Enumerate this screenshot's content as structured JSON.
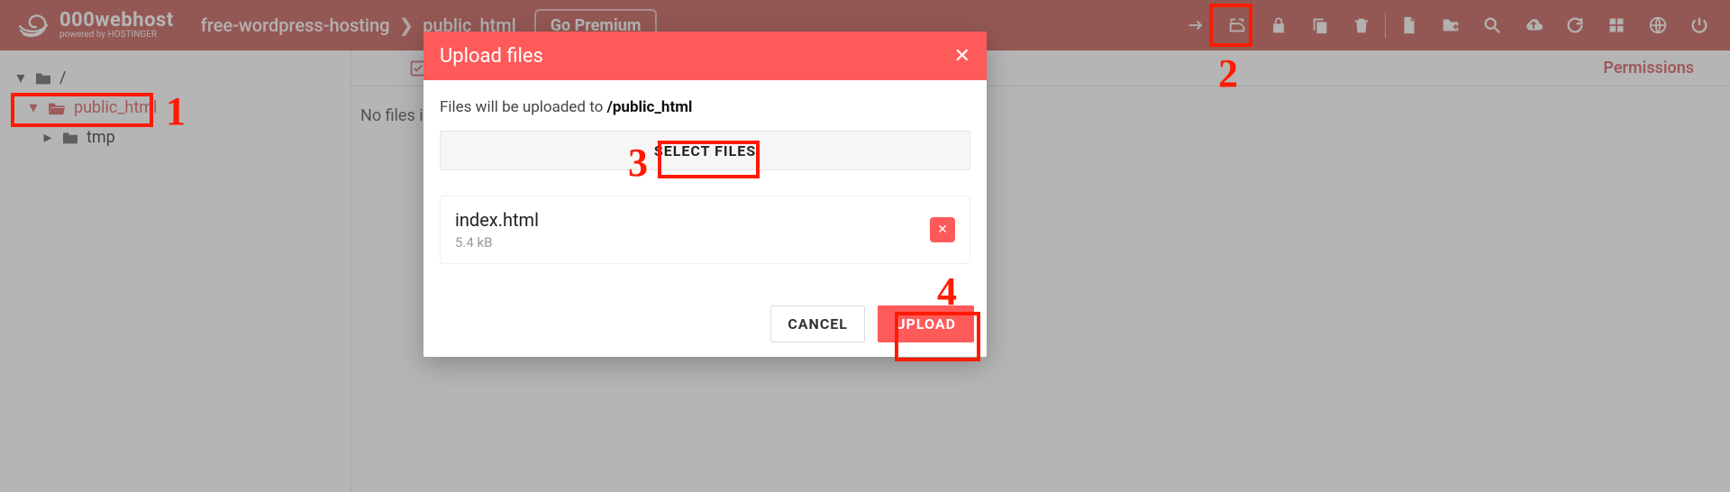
{
  "brand": {
    "name": "000webhost",
    "sub": "powered by HOSTINGER"
  },
  "breadcrumbs": {
    "site": "free-wordpress-hosting",
    "folder": "public_html"
  },
  "go_premium": "Go Premium",
  "columns": {
    "permissions": "Permissions"
  },
  "sidebar": {
    "root": "/",
    "items": [
      {
        "label": "public_html"
      },
      {
        "label": "tmp"
      }
    ]
  },
  "content": {
    "empty_text": "No files in"
  },
  "modal": {
    "title": "Upload files",
    "target_prefix": "Files will be uploaded to ",
    "target_path": "/public_html",
    "select_label": "SELECT FILES",
    "file": {
      "name": "index.html",
      "size": "5.4 kB"
    },
    "cancel": "CANCEL",
    "upload": "UPLOAD"
  },
  "annotations": {
    "n1": "1",
    "n2": "2",
    "n3": "3",
    "n4": "4"
  }
}
